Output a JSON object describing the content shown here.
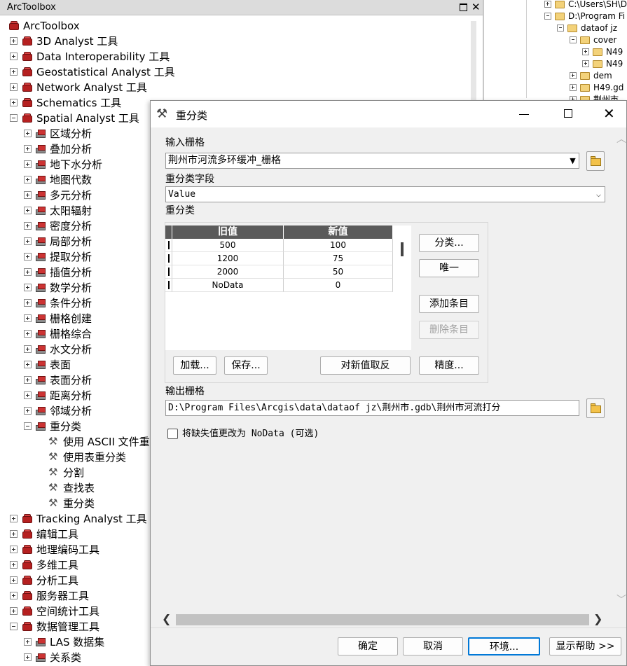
{
  "toolbox": {
    "title": "ArcToolbox",
    "items": [
      {
        "label": "ArcToolbox",
        "kind": "box",
        "level": 0,
        "exp": "none"
      },
      {
        "label": "3D Analyst 工具",
        "kind": "box",
        "level": 1,
        "exp": "plus"
      },
      {
        "label": "Data Interoperability 工具",
        "kind": "box",
        "level": 1,
        "exp": "plus"
      },
      {
        "label": "Geostatistical Analyst 工具",
        "kind": "box",
        "level": 1,
        "exp": "plus"
      },
      {
        "label": "Network Analyst 工具",
        "kind": "box",
        "level": 1,
        "exp": "plus"
      },
      {
        "label": "Schematics 工具",
        "kind": "box",
        "level": 1,
        "exp": "plus"
      },
      {
        "label": "Spatial Analyst 工具",
        "kind": "box",
        "level": 1,
        "exp": "minus"
      },
      {
        "label": "区域分析",
        "kind": "set",
        "level": 2,
        "exp": "plus"
      },
      {
        "label": "叠加分析",
        "kind": "set",
        "level": 2,
        "exp": "plus"
      },
      {
        "label": "地下水分析",
        "kind": "set",
        "level": 2,
        "exp": "plus"
      },
      {
        "label": "地图代数",
        "kind": "set",
        "level": 2,
        "exp": "plus"
      },
      {
        "label": "多元分析",
        "kind": "set",
        "level": 2,
        "exp": "plus"
      },
      {
        "label": "太阳辐射",
        "kind": "set",
        "level": 2,
        "exp": "plus"
      },
      {
        "label": "密度分析",
        "kind": "set",
        "level": 2,
        "exp": "plus"
      },
      {
        "label": "局部分析",
        "kind": "set",
        "level": 2,
        "exp": "plus"
      },
      {
        "label": "提取分析",
        "kind": "set",
        "level": 2,
        "exp": "plus"
      },
      {
        "label": "插值分析",
        "kind": "set",
        "level": 2,
        "exp": "plus"
      },
      {
        "label": "数学分析",
        "kind": "set",
        "level": 2,
        "exp": "plus"
      },
      {
        "label": "条件分析",
        "kind": "set",
        "level": 2,
        "exp": "plus"
      },
      {
        "label": "栅格创建",
        "kind": "set",
        "level": 2,
        "exp": "plus"
      },
      {
        "label": "栅格综合",
        "kind": "set",
        "level": 2,
        "exp": "plus"
      },
      {
        "label": "水文分析",
        "kind": "set",
        "level": 2,
        "exp": "plus"
      },
      {
        "label": "表面",
        "kind": "set",
        "level": 2,
        "exp": "plus"
      },
      {
        "label": "表面分析",
        "kind": "set",
        "level": 2,
        "exp": "plus"
      },
      {
        "label": "距离分析",
        "kind": "set",
        "level": 2,
        "exp": "plus"
      },
      {
        "label": "邻域分析",
        "kind": "set",
        "level": 2,
        "exp": "plus"
      },
      {
        "label": "重分类",
        "kind": "set",
        "level": 2,
        "exp": "minus"
      },
      {
        "label": "使用 ASCII 文件重分类",
        "kind": "hammer",
        "level": 3,
        "exp": "none"
      },
      {
        "label": "使用表重分类",
        "kind": "hammer",
        "level": 3,
        "exp": "none"
      },
      {
        "label": "分割",
        "kind": "hammer",
        "level": 3,
        "exp": "none"
      },
      {
        "label": "查找表",
        "kind": "hammer",
        "level": 3,
        "exp": "none"
      },
      {
        "label": "重分类",
        "kind": "hammer",
        "level": 3,
        "exp": "none"
      },
      {
        "label": "Tracking Analyst 工具",
        "kind": "box",
        "level": 1,
        "exp": "plus"
      },
      {
        "label": "编辑工具",
        "kind": "box",
        "level": 1,
        "exp": "plus"
      },
      {
        "label": "地理编码工具",
        "kind": "box",
        "level": 1,
        "exp": "plus"
      },
      {
        "label": "多维工具",
        "kind": "box",
        "level": 1,
        "exp": "plus"
      },
      {
        "label": "分析工具",
        "kind": "box",
        "level": 1,
        "exp": "plus"
      },
      {
        "label": "服务器工具",
        "kind": "box",
        "level": 1,
        "exp": "plus"
      },
      {
        "label": "空间统计工具",
        "kind": "box",
        "level": 1,
        "exp": "plus"
      },
      {
        "label": "数据管理工具",
        "kind": "box",
        "level": 1,
        "exp": "minus"
      },
      {
        "label": "LAS 数据集",
        "kind": "set",
        "level": 2,
        "exp": "plus"
      },
      {
        "label": "关系类",
        "kind": "set",
        "level": 2,
        "exp": "plus"
      }
    ]
  },
  "catalog": {
    "items": [
      {
        "label": "C:\\Users\\SH\\D",
        "level": 0,
        "exp": "plus"
      },
      {
        "label": "D:\\Program Fi",
        "level": 0,
        "exp": "minus"
      },
      {
        "label": "dataof jz",
        "level": 1,
        "exp": "minus"
      },
      {
        "label": "cover",
        "level": 2,
        "exp": "minus"
      },
      {
        "label": "N49",
        "level": 3,
        "exp": "plus"
      },
      {
        "label": "N49",
        "level": 3,
        "exp": "plus"
      },
      {
        "label": "dem",
        "level": 2,
        "exp": "plus"
      },
      {
        "label": "H49.gd",
        "level": 2,
        "exp": "plus"
      },
      {
        "label": "荆州市.",
        "level": 2,
        "exp": "plus"
      }
    ]
  },
  "dialog": {
    "title": "重分类",
    "input_raster_label": "输入栅格",
    "input_raster_value": "荆州市河流多环缓冲_栅格",
    "reclass_field_label": "重分类字段",
    "reclass_field_value": "Value",
    "reclass_label": "重分类",
    "table": {
      "headers": [
        "旧值",
        "新值"
      ],
      "rows": [
        [
          "500",
          "100"
        ],
        [
          "1200",
          "75"
        ],
        [
          "2000",
          "50"
        ],
        [
          "NoData",
          "0"
        ]
      ]
    },
    "buttons": {
      "classify": "分类...",
      "unique": "唯一",
      "add_entry": "添加条目",
      "delete_entry": "删除条目",
      "load": "加载...",
      "save": "保存...",
      "reverse": "对新值取反",
      "precision": "精度..."
    },
    "output_raster_label": "输出栅格",
    "output_raster_value": "D:\\Program Files\\Arcgis\\data\\dataof jz\\荆州市.gdb\\荆州市河流打分",
    "nodata_checkbox_label": "将缺失值更改为 NoData (可选)",
    "footer": {
      "ok": "确定",
      "cancel": "取消",
      "environments": "环境...",
      "show_help": "显示帮助 >>"
    }
  }
}
